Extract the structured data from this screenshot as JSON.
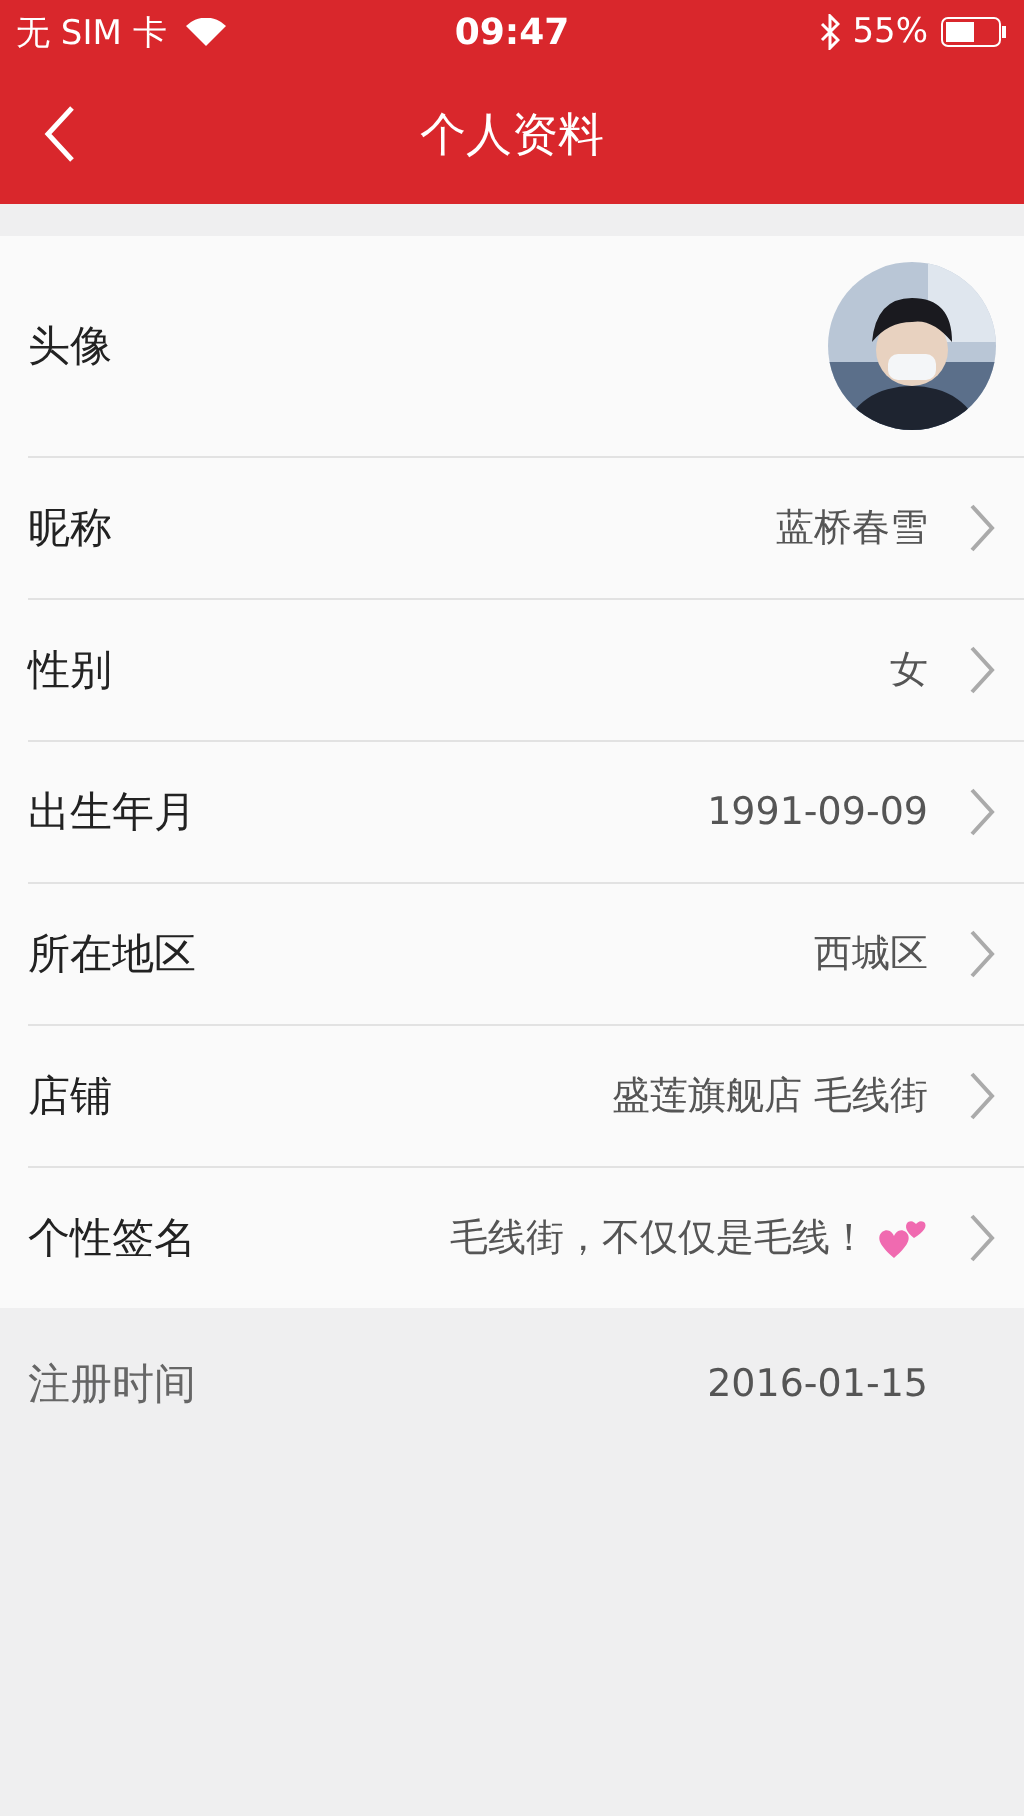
{
  "status_bar": {
    "carrier": "无 SIM 卡",
    "time": "09:47",
    "battery": "55%"
  },
  "nav": {
    "title": "个人资料"
  },
  "avatar_row": {
    "label": "头像"
  },
  "rows": [
    {
      "label": "昵称",
      "value": "蓝桥春雪",
      "kind": "text"
    },
    {
      "label": "性别",
      "value": "女",
      "kind": "text"
    },
    {
      "label": "出生年月",
      "value": "1991-09-09",
      "kind": "text"
    },
    {
      "label": "所在地区",
      "value": "西城区",
      "kind": "text"
    },
    {
      "label": "店铺",
      "value": "盛莲旗舰店 毛线街",
      "kind": "text"
    },
    {
      "label": "个性签名",
      "value": "毛线街，不仅仅是毛线！",
      "kind": "hearts"
    }
  ],
  "footer_row": {
    "label": "注册时间",
    "value": "2016-01-15"
  }
}
